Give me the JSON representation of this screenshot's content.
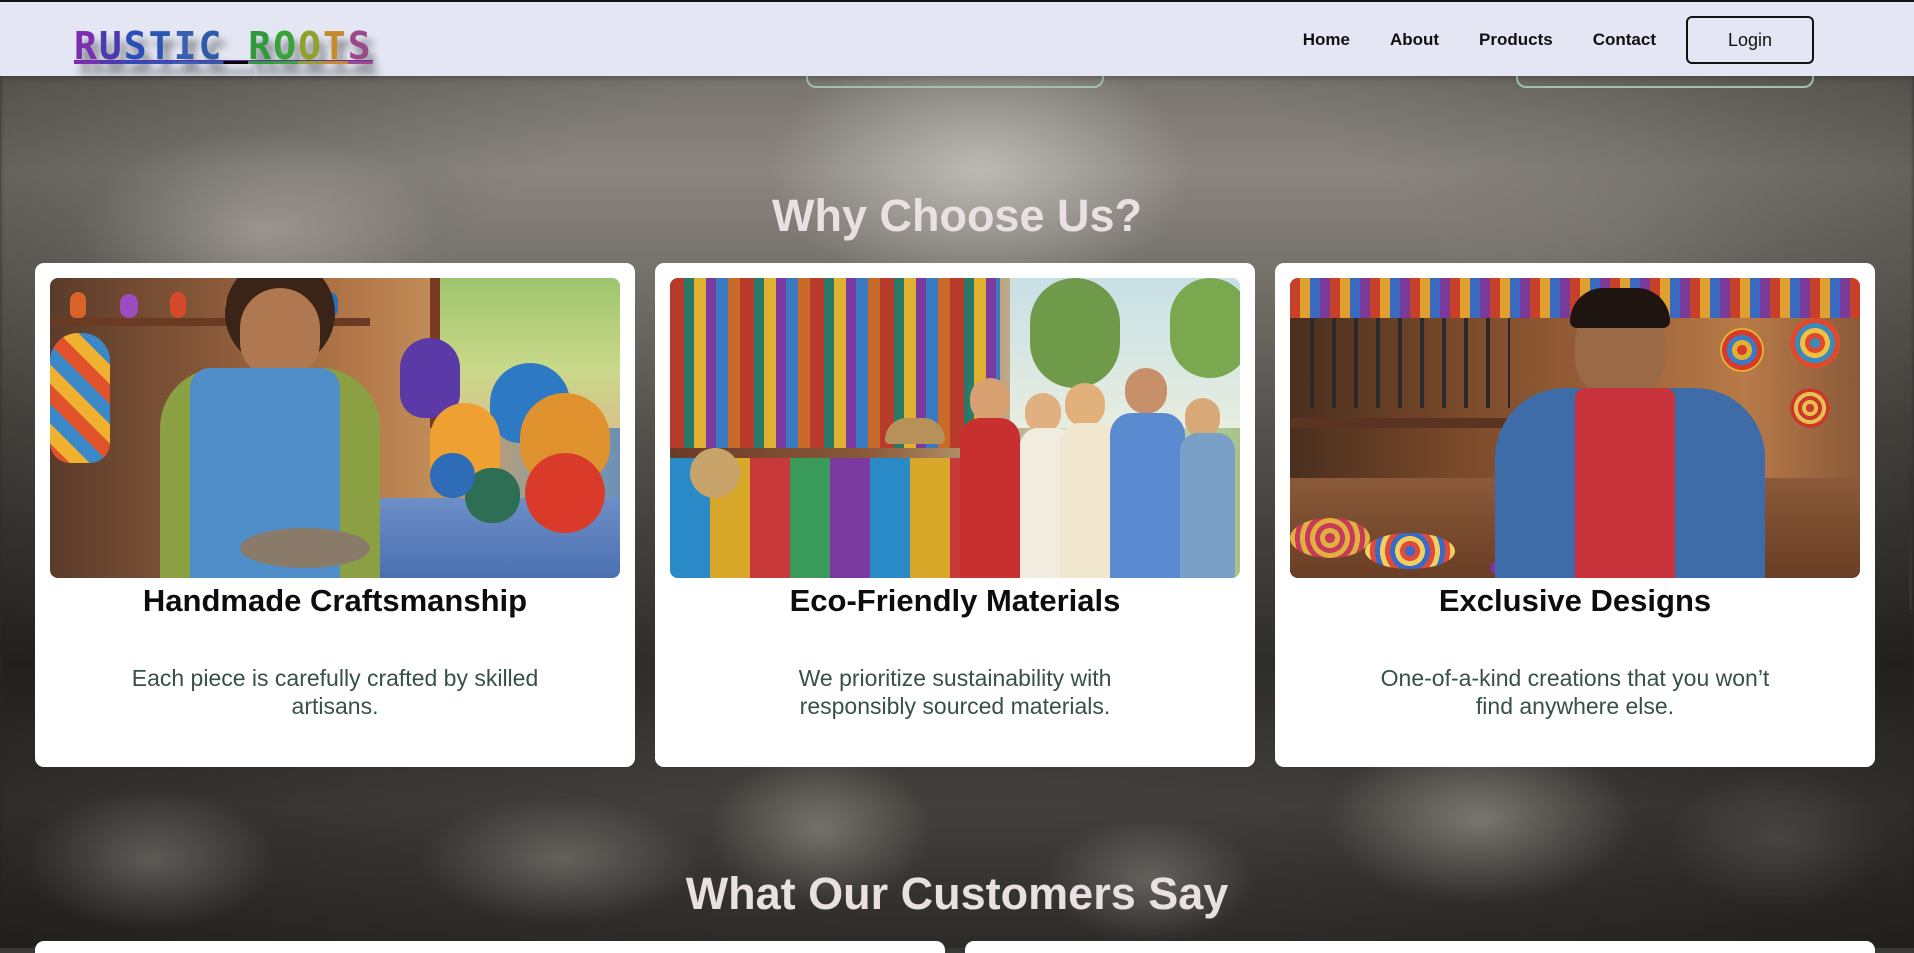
{
  "navbar": {
    "logo_letters": [
      {
        "char": "R",
        "color": "#7b2fb0"
      },
      {
        "char": "U",
        "color": "#4a3bb0"
      },
      {
        "char": "S",
        "color": "#2b4fb8"
      },
      {
        "char": "T",
        "color": "#2c55b5"
      },
      {
        "char": "I",
        "color": "#3a5fb0"
      },
      {
        "char": "C",
        "color": "#2f5aa8"
      },
      {
        "char": " ",
        "color": "#000000"
      },
      {
        "char": "R",
        "color": "#2f9a3a"
      },
      {
        "char": "O",
        "color": "#3aa23a"
      },
      {
        "char": "O",
        "color": "#8ea22b"
      },
      {
        "char": "T",
        "color": "#c58a2a"
      },
      {
        "char": "S",
        "color": "#9a4a8a"
      }
    ],
    "links": [
      "Home",
      "About",
      "Products",
      "Contact"
    ],
    "login_label": "Login"
  },
  "why": {
    "title": "Why Choose Us?",
    "cards": [
      {
        "title": "Handmade Craftsmanship",
        "text": "Each piece is carefully crafted by skilled artisans.",
        "image_icon": "pottery-artisan-image"
      },
      {
        "title": "Eco-Friendly Materials",
        "text": "We prioritize sustainability with responsibly sourced materials.",
        "image_icon": "market-stall-image"
      },
      {
        "title": "Exclusive Designs",
        "text": "One-of-a-kind creations that you won’t find anywhere else.",
        "image_icon": "workshop-craftsman-image"
      }
    ]
  },
  "testimonials": {
    "title": "What Our Customers Say"
  },
  "colors": {
    "navbar_bg": "#e4e7f3",
    "heading_text": "#e8e0e2",
    "card_text": "#37504a",
    "ghost_button_border": "#9fc2b2"
  }
}
